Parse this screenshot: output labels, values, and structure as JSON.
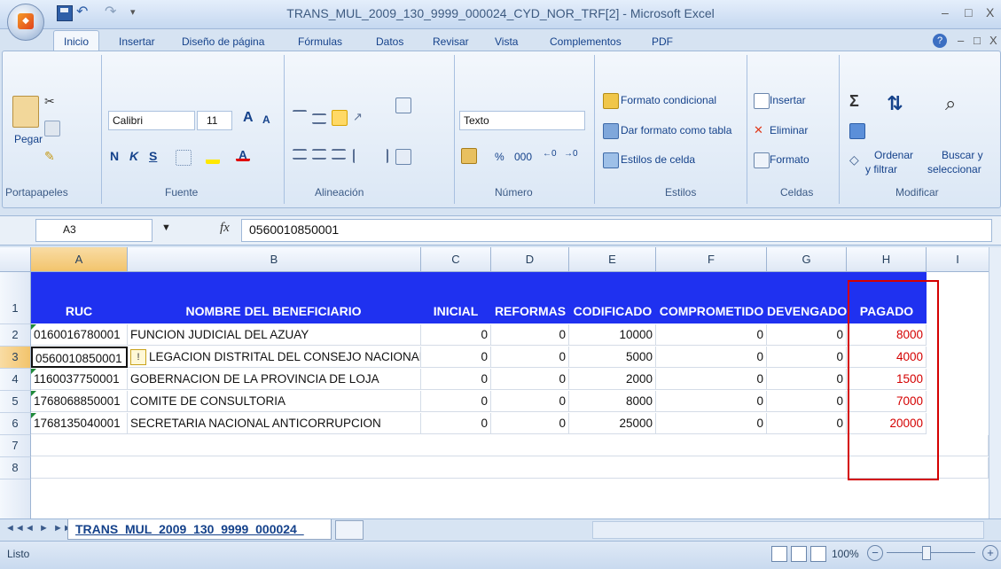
{
  "window": {
    "title": "TRANS_MUL_2009_130_9999_000024_CYD_NOR_TRF[2] - Microsoft Excel",
    "minimize": "–",
    "restore": "□",
    "close": "X"
  },
  "ribbon_tabs": [
    "Inicio",
    "Insertar",
    "Diseño de página",
    "Fórmulas",
    "Datos",
    "Revisar",
    "Vista",
    "Complementos",
    "PDF"
  ],
  "ribbon": {
    "clipboard": {
      "paste": "Pegar",
      "label": "Portapapeles"
    },
    "font": {
      "name": "Calibri",
      "size": "11",
      "bold": "N",
      "italic": "K",
      "underline": "S",
      "grow": "A",
      "shrink": "A",
      "label": "Fuente"
    },
    "alignment": {
      "label": "Alineación"
    },
    "number": {
      "format": "Texto",
      "percent": "%",
      "thousands": "000",
      "label": "Número"
    },
    "styles": {
      "conditional": "Formato condicional",
      "as_table": "Dar formato como tabla",
      "cell_styles": "Estilos de celda",
      "label": "Estilos"
    },
    "cells": {
      "insert": "Insertar",
      "delete": "Eliminar",
      "format": "Formato",
      "label": "Celdas"
    },
    "editing": {
      "sum": "Σ",
      "sort_line1": "Ordenar",
      "sort_line2": "y filtrar",
      "find_line1": "Buscar y",
      "find_line2": "seleccionar",
      "label": "Modificar"
    }
  },
  "formula_bar": {
    "name_box": "A3",
    "fx": "fx",
    "value": "0560010850001"
  },
  "columns": [
    "A",
    "B",
    "C",
    "D",
    "E",
    "F",
    "G",
    "H",
    "I"
  ],
  "row_numbers": [
    "1",
    "2",
    "3",
    "4",
    "5",
    "6",
    "7",
    "8"
  ],
  "headers": [
    "RUC",
    "NOMBRE DEL BENEFICIARIO",
    "INICIAL",
    "REFORMAS",
    "CODIFICADO",
    "COMPROMETIDO",
    "DEVENGADO",
    "PAGADO"
  ],
  "rows": [
    [
      "0160016780001",
      "FUNCION JUDICIAL DEL AZUAY",
      "0",
      "0",
      "10000",
      "0",
      "0",
      "8000"
    ],
    [
      "0560010850001",
      "LEGACION DISTRITAL DEL CONSEJO NACIONAL",
      "0",
      "0",
      "5000",
      "0",
      "0",
      "4000"
    ],
    [
      "1160037750001",
      "GOBERNACION DE LA PROVINCIA DE LOJA",
      "0",
      "0",
      "2000",
      "0",
      "0",
      "1500"
    ],
    [
      "1768068850001",
      "COMITE DE CONSULTORIA",
      "0",
      "0",
      "8000",
      "0",
      "0",
      "7000"
    ],
    [
      "1768135040001",
      "SECRETARIA NACIONAL ANTICORRUPCION",
      "0",
      "0",
      "25000",
      "0",
      "0",
      "20000"
    ]
  ],
  "sheet_tab": "TRANS_MUL_2009_130_9999_000024_",
  "status": {
    "ready": "Listo",
    "zoom": "100%"
  },
  "colors": {
    "header_fill": "#1f31f0",
    "highlight_border": "#d40000",
    "paid_text": "#d40000"
  }
}
